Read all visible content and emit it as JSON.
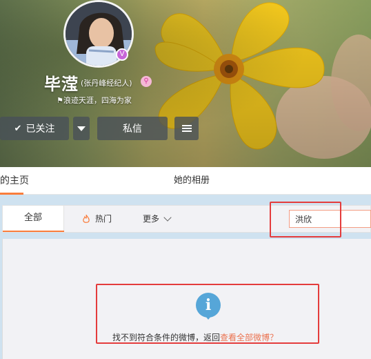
{
  "profile": {
    "name": "毕滢",
    "verified_note": "(张丹峰经纪人)",
    "bio": "浪迹天涯，四海为家",
    "avatar_badge_icon": "vip-v-icon",
    "member_icon": "pink-search-icon"
  },
  "actions": {
    "follow_label": "已关注",
    "message_label": "私信"
  },
  "nav": {
    "home_label": "的主页",
    "album_label": "她的相册"
  },
  "filter": {
    "all_label": "全部",
    "hot_label": "热门",
    "more_label": "更多",
    "search_value": "洪欣"
  },
  "empty_state": {
    "message": "找不到符合条件的微博，返回",
    "link": "查看全部微博？"
  },
  "colors": {
    "accent_orange": "#fa7d3c",
    "link_orange": "#eb7350",
    "annotation_red": "#e43b3b",
    "info_blue": "#56a6d8"
  }
}
